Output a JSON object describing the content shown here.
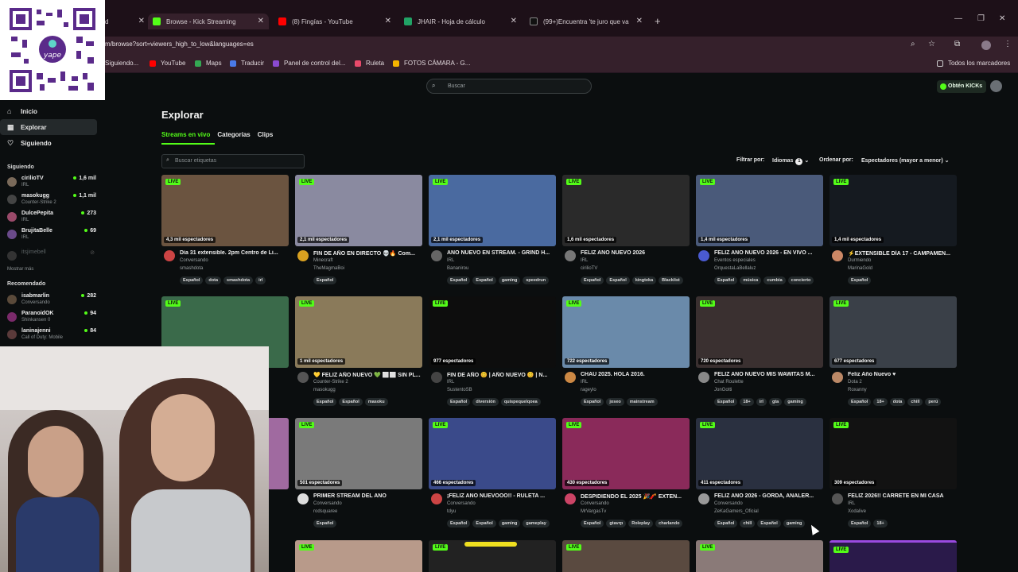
{
  "browser": {
    "tabs": [
      {
        "title": "d",
        "color": "#888888"
      },
      {
        "title": "Browse - Kick Streaming",
        "color": "#53fc18"
      },
      {
        "title": "(8) Fingías - YouTube",
        "color": "#ff0000"
      },
      {
        "title": "JHAIR - Hoja de cálculo",
        "color": "#21a366"
      },
      {
        "title": "(99+)Encuentra 'te juro que va",
        "color": "#111111"
      }
    ],
    "url": "m/browse?sort=viewers_high_to_low&languages=es",
    "bookmarks": [
      "Siguiendo...",
      "YouTube",
      "Maps",
      "Traducir",
      "Panel de control del...",
      "Ruleta",
      "FOTOS CÁMARA - G..."
    ],
    "all_bookmarks": "Todos los marcadores"
  },
  "header": {
    "search_placeholder": "Buscar",
    "kicks_button": "Obtén KICKs"
  },
  "sidebar": {
    "nav": [
      "Inicio",
      "Explorar",
      "Siguiendo"
    ],
    "following_title": "Siguiendo",
    "following": [
      {
        "name": "cirilioTV",
        "category": "IRL",
        "viewers": "1,6 mil",
        "color": "#7a6a5a"
      },
      {
        "name": "masokugg",
        "category": "Counter-Strike 2",
        "viewers": "1,1 mil",
        "color": "#333"
      },
      {
        "name": "DulcePepita",
        "category": "IRL",
        "viewers": "273",
        "color": "#9a4a6a"
      },
      {
        "name": "BrujitaBelle",
        "category": "IRL",
        "viewers": "69",
        "color": "#6a4a8a"
      },
      {
        "name": "itsjimebell",
        "category": "",
        "viewers": "",
        "color": "#333"
      }
    ],
    "more": "Mostrar más",
    "recommended_title": "Recomendado",
    "recommended": [
      {
        "name": "isabmarlin",
        "category": "Conversando",
        "viewers": "282",
        "color": "#5a4a3a"
      },
      {
        "name": "ParanoidOK",
        "category": "Shinkansen 0",
        "viewers": "94",
        "color": "#7a2a6a"
      },
      {
        "name": "laninajenni",
        "category": "Call of Duty: Mobile",
        "viewers": "84",
        "color": "#5a3a3a"
      }
    ]
  },
  "main": {
    "title": "Explorar",
    "tabs": [
      "Streams en vivo",
      "Categorías",
      "Clips"
    ],
    "tag_search": "Buscar etiquetas",
    "filter_label": "Filtrar por:",
    "filter_value": "Idiomas",
    "filter_count": "1",
    "sort_label": "Ordenar por:",
    "sort_value": "Espectadores (mayor a menor)",
    "live": "LIVE",
    "cards": [
      {
        "viewers": "4,3 mil espectadores",
        "title": "Día 31 extensible. 2pm Centro de Li...",
        "category": "Conversando",
        "channel": "smashdota",
        "tags": [
          "Español",
          "dota",
          "smashdota",
          "irl"
        ],
        "bg": "#6b5440",
        "av": "#c44"
      },
      {
        "viewers": "2,1 mil espectadores",
        "title": "FIN DE AÑO EN DIRECTO 💀🔥 Com...",
        "category": "Minecraft",
        "channel": "TheMagmaBoi",
        "tags": [
          "Español"
        ],
        "bg": "#8a8aa0",
        "av": "#d8a020"
      },
      {
        "viewers": "2,1 mil espectadores",
        "title": "AÑO NUEVO EN STREAM. - GRIND H...",
        "category": "IRL",
        "channel": "Bananirou",
        "tags": [
          "Español",
          "Español",
          "gaming",
          "speedrun"
        ],
        "bg": "#4a6aa0",
        "av": "#666"
      },
      {
        "viewers": "1,6 mil espectadores",
        "title": "FELIZ AÑO NUEVO 2026",
        "category": "IRL",
        "channel": "cirilioTV",
        "tags": [
          "Español",
          "Español",
          "kingteka",
          "Blacklist"
        ],
        "bg": "#2a2a2a",
        "av": "#777"
      },
      {
        "viewers": "1,4 mil espectadores",
        "title": "FELIZ AÑO NUEVO 2026 - EN VIVO ...",
        "category": "Eventos especiales",
        "channel": "OrquestaLaBellaluz",
        "tags": [
          "Español",
          "música",
          "cumbia",
          "concierto"
        ],
        "bg": "#4a5a7a",
        "av": "#4a5ad0"
      },
      {
        "viewers": "1,4 mil espectadores",
        "title": "⚡EXTENSIBLE DÍA 17 - CAMPAMEN...",
        "category": "Durmiendo",
        "channel": "MarinaGold",
        "tags": [
          "Español"
        ],
        "bg": "#151a20",
        "av": "#c86"
      },
      {
        "viewers": "",
        "title": "",
        "category": "",
        "channel": "",
        "tags": [],
        "bg": "#3a6a4a",
        "av": "#444"
      },
      {
        "viewers": "1 mil espectadores",
        "title": "💛 FELIZ AÑO NUEVO 💚 ⬜⬜ SIN PL...",
        "category": "Counter-Strike 2",
        "channel": "masokugg",
        "tags": [
          "Español",
          "Español",
          "masoku"
        ],
        "bg": "#8a7a5a",
        "av": "#555"
      },
      {
        "viewers": "977 espectadores",
        "title": "FIN DE AÑO 😊 | AÑO NUEVO 😊 | N...",
        "category": "IRL",
        "channel": "SustentoSB",
        "tags": [
          "Español",
          "diversión",
          "quispequelqoea"
        ],
        "bg": "#0d0d0d",
        "av": "#444"
      },
      {
        "viewers": "722 espectadores",
        "title": "CHAU 2025. HOLA 2016.",
        "category": "IRL",
        "channel": "rageylo",
        "tags": [
          "Español",
          "joseo",
          "mainstream"
        ],
        "bg": "#6a8aaa",
        "av": "#c84"
      },
      {
        "viewers": "720 espectadores",
        "title": "FELIZ AÑO NUEVO MIS WAWITAS M...",
        "category": "Chat Roulette",
        "channel": "JonGotti",
        "tags": [
          "Español",
          "18+",
          "irl",
          "gta",
          "gaming"
        ],
        "bg": "#3a3030",
        "av": "#888"
      },
      {
        "viewers": "677 espectadores",
        "title": "Feliz Año Nuevo ♥",
        "category": "Dota 2",
        "channel": "Roxanny",
        "tags": [
          "Español",
          "18+",
          "dota",
          "chill",
          "perú"
        ],
        "bg": "#3a4048",
        "av": "#b86"
      },
      {
        "viewers": "",
        "title": "",
        "category": "",
        "channel": "",
        "tags": [],
        "bg": "#a06aa0",
        "av": "#444"
      },
      {
        "viewers": "501 espectadores",
        "title": "PRIMER STREAM DEL AÑO",
        "category": "Conversando",
        "channel": "rodsquaree",
        "tags": [
          "Español"
        ],
        "bg": "#7a7a7a",
        "av": "#ddd"
      },
      {
        "viewers": "466 espectadores",
        "title": "¡FELIZ AÑO NUEVOOO!! - RULETA ...",
        "category": "Conversando",
        "channel": "tdyu",
        "tags": [
          "Español",
          "Español",
          "gaming",
          "gameplay"
        ],
        "bg": "#3a4a8a",
        "av": "#c44"
      },
      {
        "viewers": "430 espectadores",
        "title": "DESPIDIENDO EL 2025 🎉🧨 EXTEN...",
        "category": "Conversando",
        "channel": "MrVargasTv",
        "tags": [
          "Español",
          "gtavrp",
          "Roleplay",
          "charlando"
        ],
        "bg": "#8a2a5a",
        "av": "#c46"
      },
      {
        "viewers": "411 espectadores",
        "title": "FELIZ AÑO 2026 - GORDA, ANALER...",
        "category": "Conversando",
        "channel": "ZeKaGamers_Oficial",
        "tags": [
          "Español",
          "chill",
          "Español",
          "gaming"
        ],
        "bg": "#2a3040",
        "av": "#999"
      },
      {
        "viewers": "309 espectadores",
        "title": "FELIZ 2026!! CARRETE EN MI CASA",
        "category": "IRL",
        "channel": "Xodalive",
        "tags": [
          "Español",
          "18+"
        ],
        "bg": "#121212",
        "av": "#555"
      }
    ]
  }
}
